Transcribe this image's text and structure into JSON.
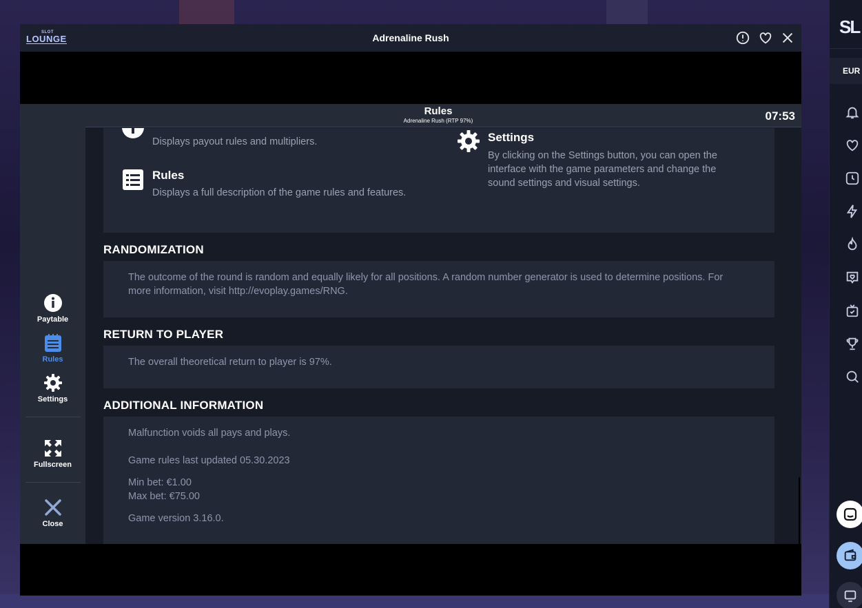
{
  "window": {
    "brand_small": "SLOT",
    "brand_main": "LOUNGE",
    "title": "Adrenaline Rush"
  },
  "game_header": {
    "title": "Rules",
    "subtitle": "Adrenaline Rush (RTP 97%)",
    "time": "07:53"
  },
  "sidebar": {
    "items": [
      {
        "label": "Paytable",
        "icon": "info-icon"
      },
      {
        "label": "Rules",
        "icon": "rules-list-icon",
        "active": true
      },
      {
        "label": "Settings",
        "icon": "gear-icon"
      },
      {
        "label": "Fullscreen",
        "icon": "fullscreen-icon"
      },
      {
        "label": "Close",
        "icon": "close-icon"
      }
    ]
  },
  "features": {
    "paytable_desc": "Displays payout rules and multipliers.",
    "rules_title": "Rules",
    "rules_desc": "Displays a full description of the game rules and features.",
    "settings_title": "Settings",
    "settings_desc": "By clicking on the Settings button, you can open the interface with the game parameters and change the sound settings and visual settings."
  },
  "sections": {
    "randomization": {
      "heading": "RANDOMIZATION",
      "text": "The outcome of the round is random and equally likely for all positions. A random number generator is used to determine positions. For more information, visit http://evoplay.games/RNG."
    },
    "rtp": {
      "heading": "RETURN TO PLAYER",
      "text": "The overall theoretical return to player is 97%."
    },
    "additional": {
      "heading": "ADDITIONAL INFORMATION",
      "malfunction": "Malfunction voids all pays and plays.",
      "updated": "Game rules last updated 05.30.2023",
      "min_bet": "Min bet: €1.00",
      "max_bet": "Max bet: €75.00",
      "version": "Game version 3.16.0."
    }
  },
  "rail": {
    "logo": "SL",
    "currency": "EUR",
    "icons": [
      "bell-icon",
      "heart-icon",
      "clock-icon",
      "lightning-icon",
      "flame-icon",
      "heart-chat-icon",
      "tv-icon",
      "trophy-icon",
      "search-icon",
      "chat-face-icon",
      "wallet-icon",
      "screen-icon"
    ]
  },
  "colors": {
    "accent": "#4c8dea",
    "panel": "#232836",
    "sidebar": "#262b38",
    "muted_text": "#8e96ab"
  }
}
